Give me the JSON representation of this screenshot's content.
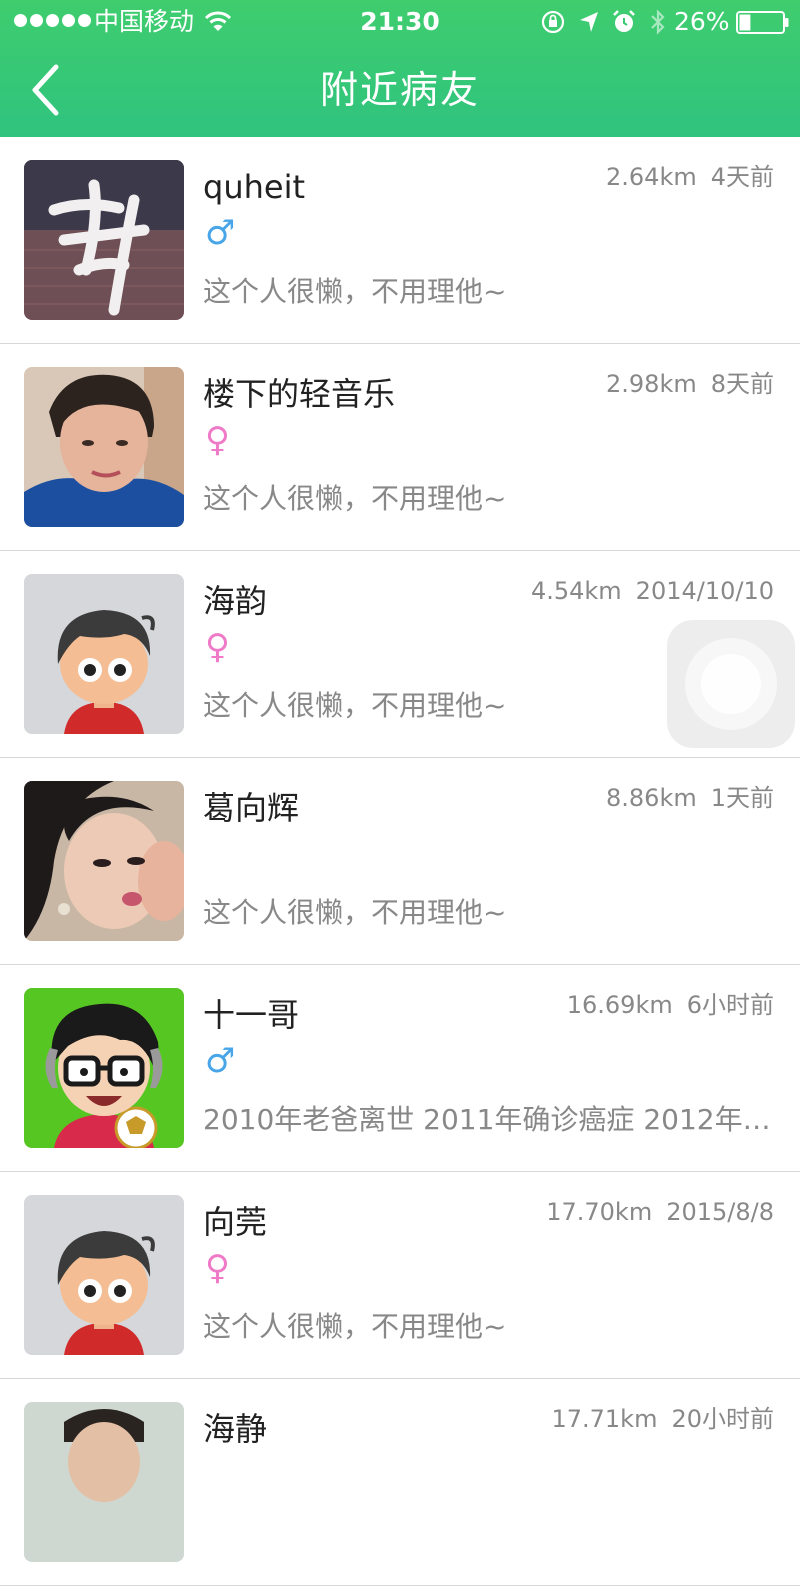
{
  "status_bar": {
    "carrier": "中国移动",
    "time": "21:30",
    "battery": "26%",
    "battery_level": 0.26,
    "icons": [
      "signal-dots-icon",
      "wifi-icon",
      "orientation-lock-icon",
      "location-icon",
      "alarm-icon",
      "bluetooth-icon",
      "battery-icon"
    ]
  },
  "nav": {
    "title": "附近病友",
    "back_icon": "chevron-left-icon"
  },
  "users": [
    {
      "name": "quheit",
      "gender": "male",
      "gender_symbol": "♂",
      "distance": "2.64km",
      "time": "4天前",
      "signature": "这个人很懒，不用理他~",
      "avatar": "calligraphy-avatar"
    },
    {
      "name": "楼下的轻音乐",
      "gender": "female",
      "gender_symbol": "♀",
      "distance": "2.98km",
      "time": "8天前",
      "signature": "这个人很懒，不用理他~",
      "avatar": "photo-avatar"
    },
    {
      "name": "海韵",
      "gender": "female",
      "gender_symbol": "♀",
      "distance": "4.54km",
      "time": "2014/10/10",
      "signature": "这个人很懒，不用理他~",
      "avatar": "default-cartoon-avatar"
    },
    {
      "name": "葛向辉",
      "gender": "",
      "gender_symbol": "",
      "distance": "8.86km",
      "time": "1天前",
      "signature": "这个人很懒，不用理他~",
      "avatar": "photo-avatar"
    },
    {
      "name": "十一哥",
      "gender": "male",
      "gender_symbol": "♂",
      "distance": "16.69km",
      "time": "6小时前",
      "signature": "2010年老爸离世  2011年确诊癌症  2012年…",
      "avatar": "cartoon-glasses-avatar"
    },
    {
      "name": "向莞",
      "gender": "female",
      "gender_symbol": "♀",
      "distance": "17.70km",
      "time": "2015/8/8",
      "signature": "这个人很懒，不用理他~",
      "avatar": "default-cartoon-avatar"
    },
    {
      "name": "海静",
      "gender": "",
      "gender_symbol": "",
      "distance": "17.71km",
      "time": "20小时前",
      "signature": "",
      "avatar": "photo-avatar"
    }
  ],
  "colors": {
    "header": "#3cc974",
    "male": "#48a5e8",
    "female": "#ef7ac8",
    "meta_text": "#888888"
  }
}
